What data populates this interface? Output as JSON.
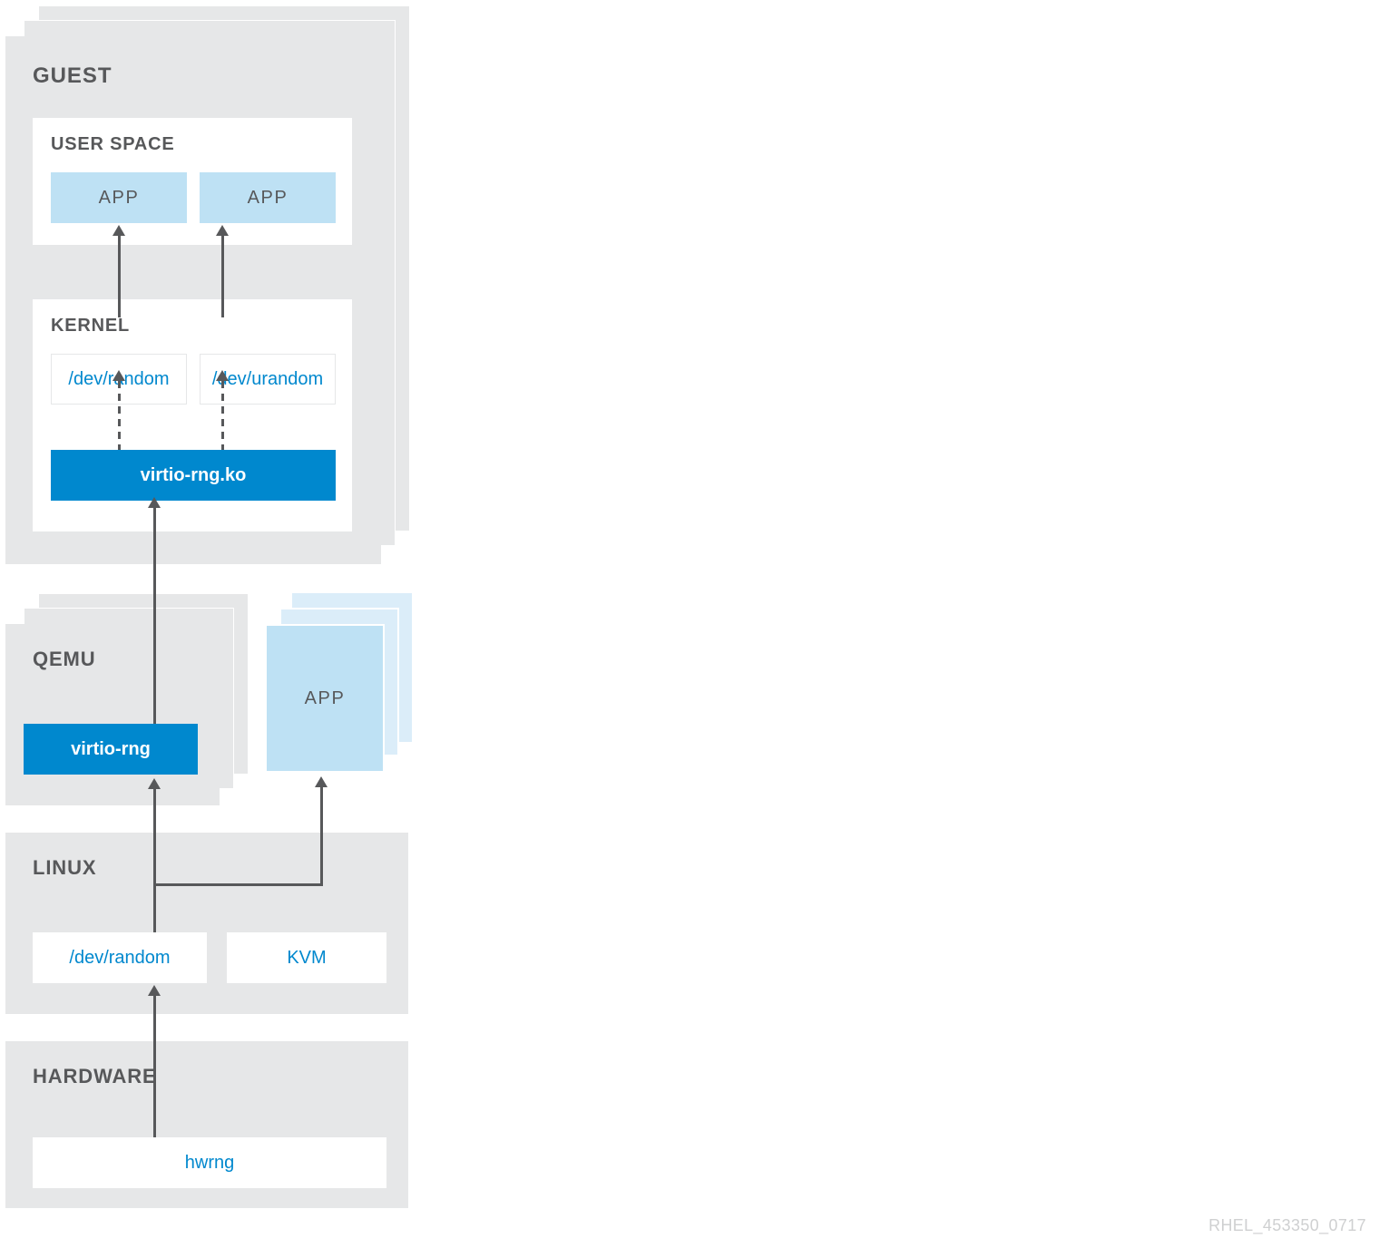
{
  "guest": {
    "title": "GUEST",
    "user_space": {
      "title": "USER SPACE",
      "apps": [
        "APP",
        "APP"
      ]
    },
    "kernel": {
      "title": "KERNEL",
      "dev_random": "/dev/random",
      "dev_urandom": "/dev/urandom",
      "virtio_rng_ko": "virtio-rng.ko"
    }
  },
  "qemu": {
    "title": "QEMU",
    "virtio_rng": "virtio-rng"
  },
  "host_app": "APP",
  "linux": {
    "title": "LINUX",
    "dev_random": "/dev/random",
    "kvm": "KVM"
  },
  "hardware": {
    "title": "HARDWARE",
    "hwrng": "hwrng"
  },
  "footer_id": "RHEL_453350_0717"
}
